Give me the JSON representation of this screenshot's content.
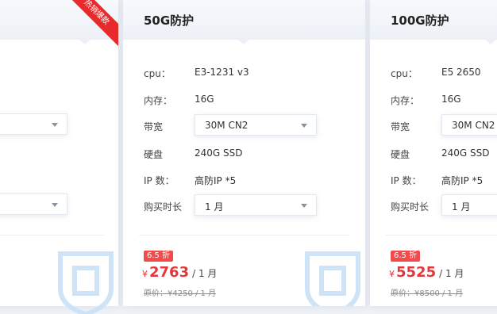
{
  "cards": [
    {
      "title": "",
      "ribbon": "热销爆款",
      "bandwidth": "",
      "duration": ""
    },
    {
      "title": "50G防护",
      "specs": {
        "cpu_label": "cpu：",
        "cpu_value": "E3-1231 v3",
        "ram_label": "内存：",
        "ram_value": "16G",
        "bw_label": "带宽",
        "bw_value": "30M CN2",
        "disk_label": "硬盘",
        "disk_value": "240G SSD",
        "ip_label": "IP 数：",
        "ip_value": "高防IP *5",
        "dur_label": "购买时长",
        "dur_value": "1 月"
      },
      "discount": "6.5 折",
      "currency": "¥",
      "price": "2763",
      "per": "/ 1 月",
      "original": "原价：¥4250 / 1 月"
    },
    {
      "title": "100G防护",
      "specs": {
        "cpu_label": "cpu：",
        "cpu_value": "E5 2650",
        "ram_label": "内存：",
        "ram_value": "16G",
        "bw_label": "带宽",
        "bw_value": "30M CN2",
        "disk_label": "硬盘",
        "disk_value": "240G SSD",
        "ip_label": "IP 数：",
        "ip_value": "高防IP *5",
        "dur_label": "购买时长",
        "dur_value": "1 月"
      },
      "discount": "6.5 折",
      "currency": "¥",
      "price": "5525",
      "per": "/ 1 月",
      "original": "原价：¥8500 / 1 月"
    }
  ],
  "colors": {
    "accent_red": "#e4393c",
    "ribbon_red": "#e82a2a",
    "shield_blue": "#cfe3f7"
  },
  "icons": [
    "shield-icon",
    "chevron-down-icon"
  ]
}
